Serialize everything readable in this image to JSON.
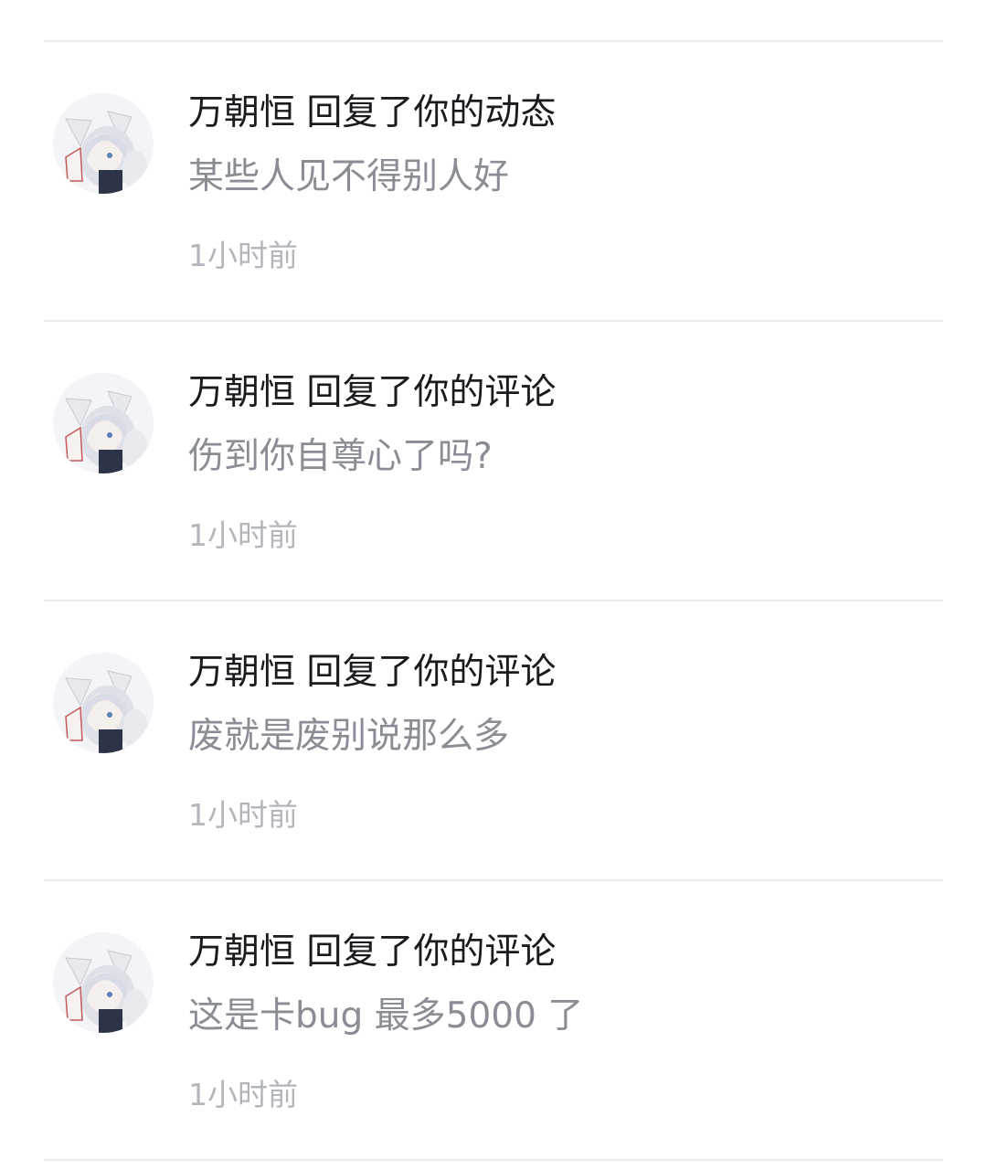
{
  "notifications": [
    {
      "avatar_icon": "user-avatar-icon",
      "title": "万朝恒 回复了你的动态",
      "content": "某些人见不得别人好",
      "time": "1小时前"
    },
    {
      "avatar_icon": "user-avatar-icon",
      "title": "万朝恒 回复了你的评论",
      "content": "伤到你自尊心了吗?",
      "time": "1小时前"
    },
    {
      "avatar_icon": "user-avatar-icon",
      "title": "万朝恒 回复了你的评论",
      "content": "废就是废别说那么多",
      "time": "1小时前"
    },
    {
      "avatar_icon": "user-avatar-icon",
      "title": "万朝恒 回复了你的评论",
      "content": "这是卡bug 最多5000 了",
      "time": "1小时前"
    }
  ],
  "colors": {
    "title": "#1b1b1f",
    "content": "#8a8d94",
    "time": "#b3b6bb",
    "divider": "#ececee"
  }
}
